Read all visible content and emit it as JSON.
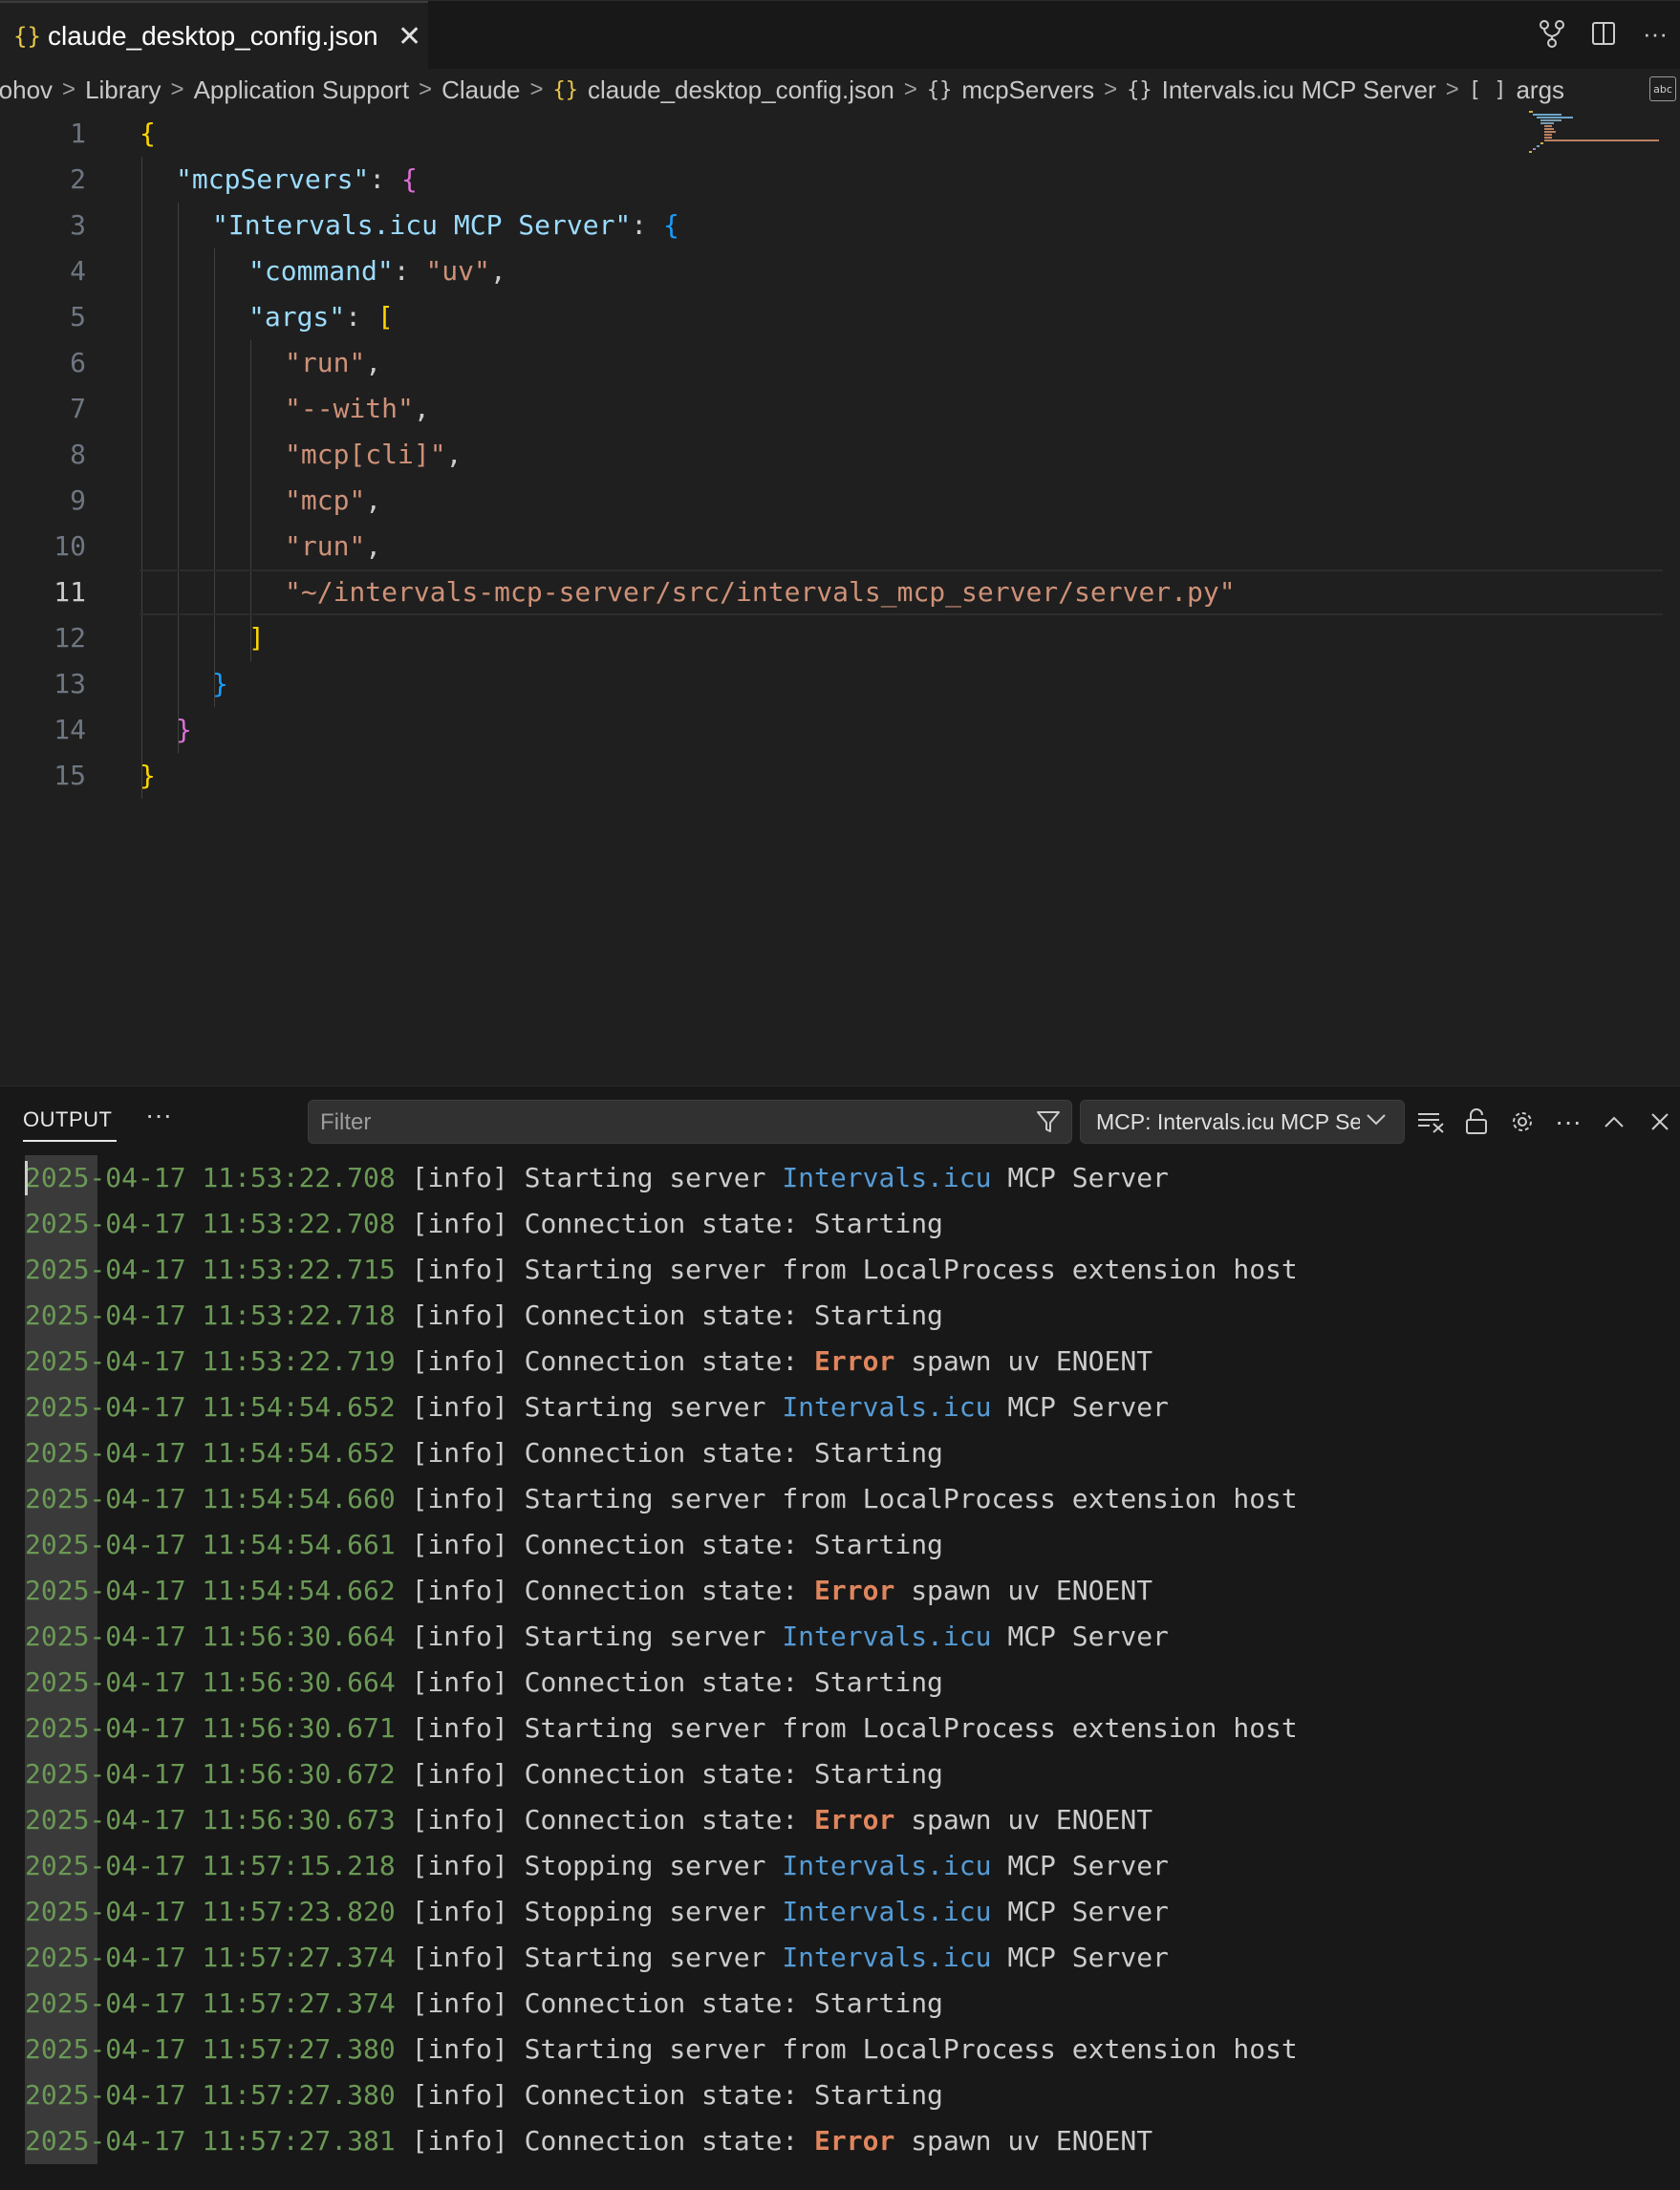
{
  "tab": {
    "label": "claude_desktop_config.json"
  },
  "breadcrumbs": [
    {
      "label": "rohov",
      "icon": ""
    },
    {
      "label": "Library",
      "icon": ""
    },
    {
      "label": "Application Support",
      "icon": ""
    },
    {
      "label": "Claude",
      "icon": ""
    },
    {
      "label": "claude_desktop_config.json",
      "icon": "{}"
    },
    {
      "label": "mcpServers",
      "icon": "{}"
    },
    {
      "label": "Intervals.icu MCP Server",
      "icon": "{}"
    },
    {
      "label": "args",
      "icon": "[ ]"
    }
  ],
  "editor": {
    "line_numbers": [
      "1",
      "2",
      "3",
      "4",
      "5",
      "6",
      "7",
      "8",
      "9",
      "10",
      "11",
      "12",
      "13",
      "14",
      "15"
    ],
    "current_line": 11,
    "code": {
      "l1_open": "{",
      "l2_key": "\"mcpServers\"",
      "l2_colon": ": ",
      "l2_open": "{",
      "l3_key": "\"Intervals.icu MCP Server\"",
      "l3_colon": ": ",
      "l3_open": "{",
      "l4_key": "\"command\"",
      "l4_colon": ": ",
      "l4_val": "\"uv\"",
      "l4_comma": ",",
      "l5_key": "\"args\"",
      "l5_colon": ": ",
      "l5_open": "[",
      "l6": "\"run\"",
      "l7": "\"--with\"",
      "l8": "\"mcp[cli]\"",
      "l9": "\"mcp\"",
      "l10": "\"run\"",
      "l11": "\"~/intervals-mcp-server/src/intervals_mcp_server/server.py\"",
      "comma": ",",
      "l12_close": "]",
      "l13_close": "}",
      "l14_close": "}",
      "l15_close": "}"
    }
  },
  "output": {
    "title": "OUTPUT",
    "more": "···",
    "filter_placeholder": "Filter",
    "channel": "MCP: Intervals.icu MCP Server",
    "level": "[info]",
    "server_name": "Intervals.icu",
    "error_word": "Error",
    "logs": [
      {
        "ts": "2025-04-17 11:53:22.708",
        "kind": "start",
        "pre": "Starting server ",
        "post": " MCP Server"
      },
      {
        "ts": "2025-04-17 11:53:22.708",
        "kind": "plain",
        "text": "Connection state: Starting"
      },
      {
        "ts": "2025-04-17 11:53:22.715",
        "kind": "plain",
        "text": "Starting server from LocalProcess extension host"
      },
      {
        "ts": "2025-04-17 11:53:22.718",
        "kind": "plain",
        "text": "Connection state: Starting"
      },
      {
        "ts": "2025-04-17 11:53:22.719",
        "kind": "error",
        "pre": "Connection state: ",
        "post": " spawn uv ENOENT"
      },
      {
        "ts": "2025-04-17 11:54:54.652",
        "kind": "start",
        "pre": "Starting server ",
        "post": " MCP Server"
      },
      {
        "ts": "2025-04-17 11:54:54.652",
        "kind": "plain",
        "text": "Connection state: Starting"
      },
      {
        "ts": "2025-04-17 11:54:54.660",
        "kind": "plain",
        "text": "Starting server from LocalProcess extension host"
      },
      {
        "ts": "2025-04-17 11:54:54.661",
        "kind": "plain",
        "text": "Connection state: Starting"
      },
      {
        "ts": "2025-04-17 11:54:54.662",
        "kind": "error",
        "pre": "Connection state: ",
        "post": " spawn uv ENOENT"
      },
      {
        "ts": "2025-04-17 11:56:30.664",
        "kind": "start",
        "pre": "Starting server ",
        "post": " MCP Server"
      },
      {
        "ts": "2025-04-17 11:56:30.664",
        "kind": "plain",
        "text": "Connection state: Starting"
      },
      {
        "ts": "2025-04-17 11:56:30.671",
        "kind": "plain",
        "text": "Starting server from LocalProcess extension host"
      },
      {
        "ts": "2025-04-17 11:56:30.672",
        "kind": "plain",
        "text": "Connection state: Starting"
      },
      {
        "ts": "2025-04-17 11:56:30.673",
        "kind": "error",
        "pre": "Connection state: ",
        "post": " spawn uv ENOENT"
      },
      {
        "ts": "2025-04-17 11:57:15.218",
        "kind": "start",
        "pre": "Stopping server ",
        "post": " MCP Server"
      },
      {
        "ts": "2025-04-17 11:57:23.820",
        "kind": "start",
        "pre": "Stopping server ",
        "post": " MCP Server"
      },
      {
        "ts": "2025-04-17 11:57:27.374",
        "kind": "start",
        "pre": "Starting server ",
        "post": " MCP Server"
      },
      {
        "ts": "2025-04-17 11:57:27.374",
        "kind": "plain",
        "text": "Connection state: Starting"
      },
      {
        "ts": "2025-04-17 11:57:27.380",
        "kind": "plain",
        "text": "Starting server from LocalProcess extension host"
      },
      {
        "ts": "2025-04-17 11:57:27.380",
        "kind": "plain",
        "text": "Connection state: Starting"
      },
      {
        "ts": "2025-04-17 11:57:27.381",
        "kind": "error",
        "pre": "Connection state: ",
        "post": " spawn uv ENOENT"
      }
    ]
  },
  "icons": {
    "tab_file": "json-file-icon",
    "tab_close": "close-icon",
    "source_control": "source-control-icon",
    "split_editor": "split-editor-icon",
    "more_actions": "more-icon",
    "filter": "funnel-icon",
    "clear_output": "clear-output-icon",
    "lock_scroll": "lock-icon",
    "settings": "gear-icon",
    "maximize": "chevron-up-icon",
    "close_panel": "close-icon"
  }
}
